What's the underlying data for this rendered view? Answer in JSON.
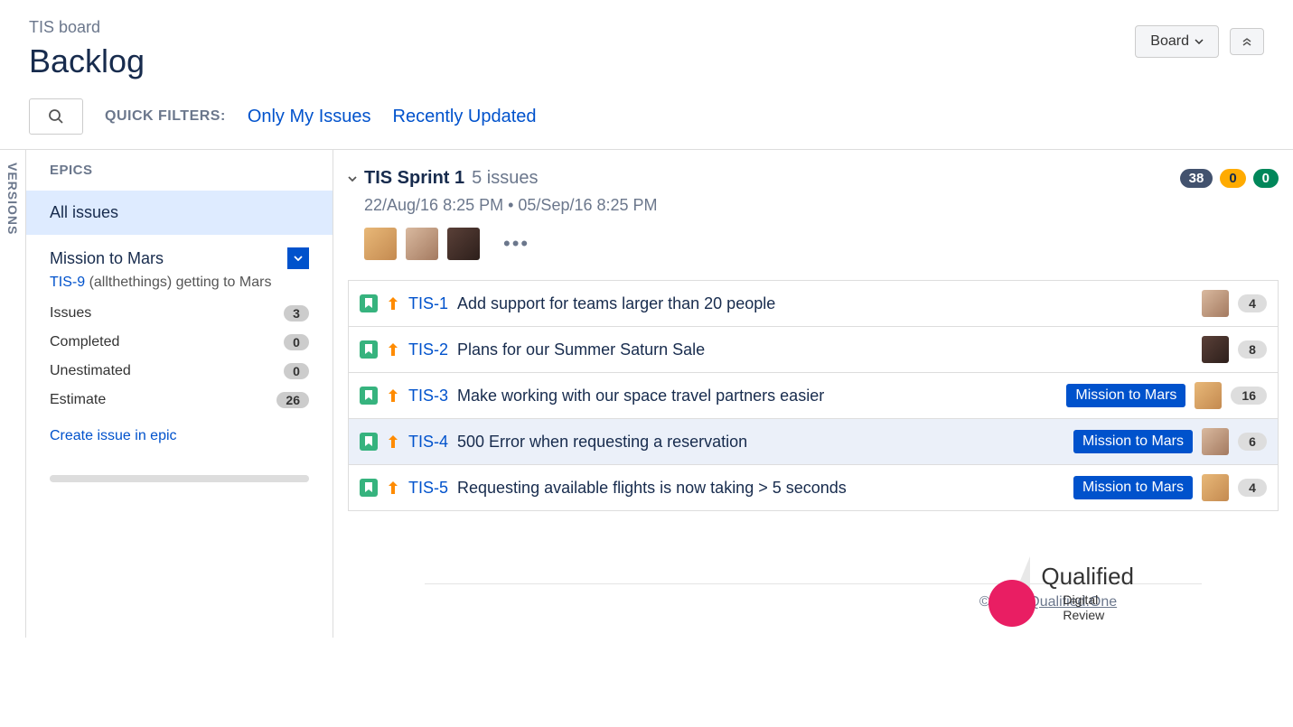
{
  "header": {
    "breadcrumb": "TIS board",
    "title": "Backlog",
    "board_button": "Board",
    "expand_aria": "Expand"
  },
  "filters": {
    "label": "QUICK FILTERS:",
    "only_my_issues": "Only My Issues",
    "recently_updated": "Recently Updated"
  },
  "versions_tab": "VERSIONS",
  "sidebar": {
    "epics_label": "EPICS",
    "all_issues": "All issues",
    "epic": {
      "name": "Mission to Mars",
      "link_key": "TIS-9",
      "link_desc": "(allthethings) getting to Mars",
      "stats": {
        "issues_label": "Issues",
        "issues_value": "3",
        "completed_label": "Completed",
        "completed_value": "0",
        "unestimated_label": "Unestimated",
        "unestimated_value": "0",
        "estimate_label": "Estimate",
        "estimate_value": "26"
      },
      "create_link": "Create issue in epic"
    }
  },
  "sprint": {
    "title": "TIS Sprint 1",
    "count_text": "5 issues",
    "dates": "22/Aug/16 8:25 PM  •  05/Sep/16 8:25 PM",
    "badges": {
      "todo": "38",
      "inprogress": "0",
      "done": "0"
    }
  },
  "issues": [
    {
      "key": "TIS-1",
      "summary": "Add support for teams larger than 20 people",
      "epic": null,
      "points": "4",
      "assignee": "b",
      "highlighted": false
    },
    {
      "key": "TIS-2",
      "summary": "Plans for our Summer Saturn Sale",
      "epic": null,
      "points": "8",
      "assignee": "c",
      "highlighted": false
    },
    {
      "key": "TIS-3",
      "summary": "Make working with our space travel partners easier",
      "epic": "Mission to Mars",
      "points": "16",
      "assignee": "a",
      "highlighted": false
    },
    {
      "key": "TIS-4",
      "summary": "500 Error when requesting a reservation",
      "epic": "Mission to Mars",
      "points": "6",
      "assignee": "b",
      "highlighted": true
    },
    {
      "key": "TIS-5",
      "summary": "Requesting available flights is now taking > 5 seconds",
      "epic": "Mission to Mars",
      "points": "4",
      "assignee": "a",
      "highlighted": false
    }
  ],
  "avatar_colors": {
    "a": "linear-gradient(135deg,#e8b878,#c48a50)",
    "b": "linear-gradient(135deg,#d9b99f,#a47a60)",
    "c": "linear-gradient(135deg,#5a4038,#2d1f1b)"
  },
  "footer": {
    "copyright_prefix": "© ",
    "copyright_link": "www.Qualified.One",
    "logo_name": "Qualified",
    "logo_sub1": "Digital",
    "logo_sub2": "Review"
  }
}
